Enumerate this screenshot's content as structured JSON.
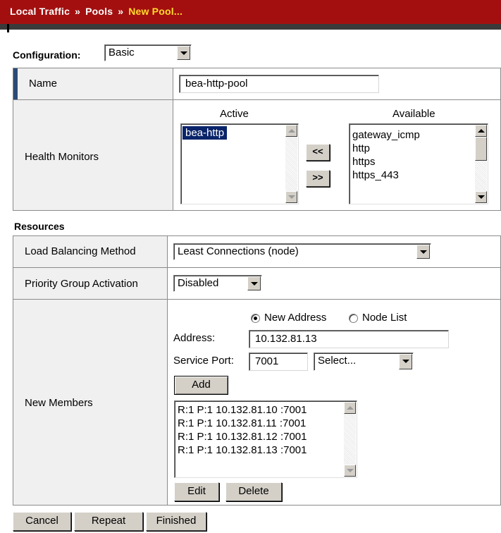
{
  "breadcrumb": {
    "items": [
      "Local Traffic",
      "Pools"
    ],
    "separator": "»",
    "current": "New Pool..."
  },
  "config": {
    "label": "Configuration:",
    "selected": "Basic"
  },
  "name_row": {
    "label": "Name",
    "value": "bea-http-pool"
  },
  "health": {
    "label": "Health Monitors",
    "active_header": "Active",
    "available_header": "Available",
    "active_items": [
      "bea-http"
    ],
    "available_items": [
      "gateway_icmp",
      "http",
      "https",
      "https_443"
    ],
    "move_left": "<<",
    "move_right": ">>"
  },
  "resources": {
    "title": "Resources",
    "lb_label": "Load Balancing Method",
    "lb_value": "Least Connections (node)",
    "priority_label": "Priority Group Activation",
    "priority_value": "Disabled"
  },
  "members": {
    "label": "New Members",
    "radio_new": "New Address",
    "radio_node": "Node List",
    "address_label": "Address:",
    "address_value": "10.132.81.13",
    "port_label": "Service Port:",
    "port_value": "7001",
    "port_select": "Select...",
    "add_label": "Add",
    "list": [
      "R:1 P:1 10.132.81.10 :7001",
      "R:1 P:1 10.132.81.11 :7001",
      "R:1 P:1 10.132.81.12 :7001",
      "R:1 P:1 10.132.81.13 :7001"
    ],
    "edit_label": "Edit",
    "delete_label": "Delete"
  },
  "footer": {
    "cancel": "Cancel",
    "repeat": "Repeat",
    "finished": "Finished"
  },
  "colors": {
    "header_bg": "#a30f0f",
    "current_crumb": "#ffdc2a",
    "selection": "#0a246a",
    "name_marker": "#2b4a78"
  }
}
